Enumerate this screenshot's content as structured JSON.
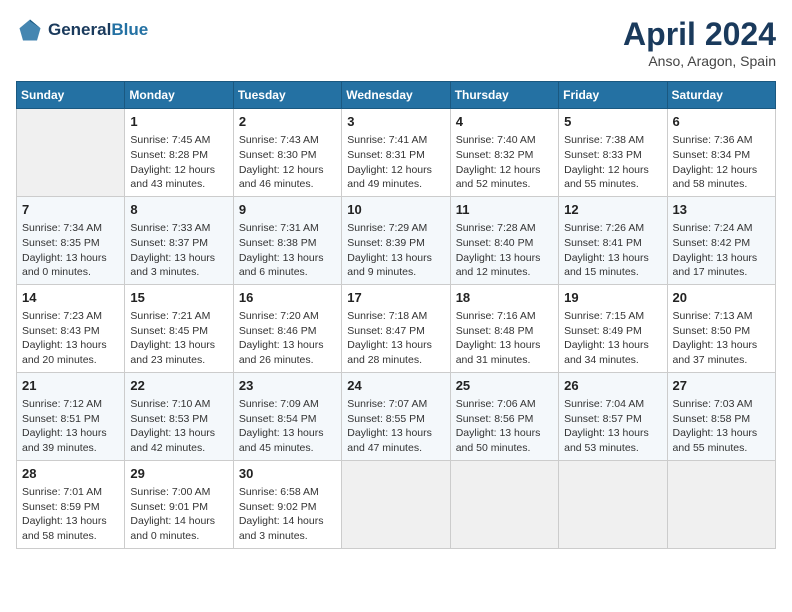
{
  "header": {
    "logo_line1": "General",
    "logo_line2": "Blue",
    "month": "April 2024",
    "location": "Anso, Aragon, Spain"
  },
  "days_of_week": [
    "Sunday",
    "Monday",
    "Tuesday",
    "Wednesday",
    "Thursday",
    "Friday",
    "Saturday"
  ],
  "weeks": [
    [
      {
        "day": "",
        "sunrise": "",
        "sunset": "",
        "daylight": ""
      },
      {
        "day": "1",
        "sunrise": "Sunrise: 7:45 AM",
        "sunset": "Sunset: 8:28 PM",
        "daylight": "Daylight: 12 hours and 43 minutes."
      },
      {
        "day": "2",
        "sunrise": "Sunrise: 7:43 AM",
        "sunset": "Sunset: 8:30 PM",
        "daylight": "Daylight: 12 hours and 46 minutes."
      },
      {
        "day": "3",
        "sunrise": "Sunrise: 7:41 AM",
        "sunset": "Sunset: 8:31 PM",
        "daylight": "Daylight: 12 hours and 49 minutes."
      },
      {
        "day": "4",
        "sunrise": "Sunrise: 7:40 AM",
        "sunset": "Sunset: 8:32 PM",
        "daylight": "Daylight: 12 hours and 52 minutes."
      },
      {
        "day": "5",
        "sunrise": "Sunrise: 7:38 AM",
        "sunset": "Sunset: 8:33 PM",
        "daylight": "Daylight: 12 hours and 55 minutes."
      },
      {
        "day": "6",
        "sunrise": "Sunrise: 7:36 AM",
        "sunset": "Sunset: 8:34 PM",
        "daylight": "Daylight: 12 hours and 58 minutes."
      }
    ],
    [
      {
        "day": "7",
        "sunrise": "Sunrise: 7:34 AM",
        "sunset": "Sunset: 8:35 PM",
        "daylight": "Daylight: 13 hours and 0 minutes."
      },
      {
        "day": "8",
        "sunrise": "Sunrise: 7:33 AM",
        "sunset": "Sunset: 8:37 PM",
        "daylight": "Daylight: 13 hours and 3 minutes."
      },
      {
        "day": "9",
        "sunrise": "Sunrise: 7:31 AM",
        "sunset": "Sunset: 8:38 PM",
        "daylight": "Daylight: 13 hours and 6 minutes."
      },
      {
        "day": "10",
        "sunrise": "Sunrise: 7:29 AM",
        "sunset": "Sunset: 8:39 PM",
        "daylight": "Daylight: 13 hours and 9 minutes."
      },
      {
        "day": "11",
        "sunrise": "Sunrise: 7:28 AM",
        "sunset": "Sunset: 8:40 PM",
        "daylight": "Daylight: 13 hours and 12 minutes."
      },
      {
        "day": "12",
        "sunrise": "Sunrise: 7:26 AM",
        "sunset": "Sunset: 8:41 PM",
        "daylight": "Daylight: 13 hours and 15 minutes."
      },
      {
        "day": "13",
        "sunrise": "Sunrise: 7:24 AM",
        "sunset": "Sunset: 8:42 PM",
        "daylight": "Daylight: 13 hours and 17 minutes."
      }
    ],
    [
      {
        "day": "14",
        "sunrise": "Sunrise: 7:23 AM",
        "sunset": "Sunset: 8:43 PM",
        "daylight": "Daylight: 13 hours and 20 minutes."
      },
      {
        "day": "15",
        "sunrise": "Sunrise: 7:21 AM",
        "sunset": "Sunset: 8:45 PM",
        "daylight": "Daylight: 13 hours and 23 minutes."
      },
      {
        "day": "16",
        "sunrise": "Sunrise: 7:20 AM",
        "sunset": "Sunset: 8:46 PM",
        "daylight": "Daylight: 13 hours and 26 minutes."
      },
      {
        "day": "17",
        "sunrise": "Sunrise: 7:18 AM",
        "sunset": "Sunset: 8:47 PM",
        "daylight": "Daylight: 13 hours and 28 minutes."
      },
      {
        "day": "18",
        "sunrise": "Sunrise: 7:16 AM",
        "sunset": "Sunset: 8:48 PM",
        "daylight": "Daylight: 13 hours and 31 minutes."
      },
      {
        "day": "19",
        "sunrise": "Sunrise: 7:15 AM",
        "sunset": "Sunset: 8:49 PM",
        "daylight": "Daylight: 13 hours and 34 minutes."
      },
      {
        "day": "20",
        "sunrise": "Sunrise: 7:13 AM",
        "sunset": "Sunset: 8:50 PM",
        "daylight": "Daylight: 13 hours and 37 minutes."
      }
    ],
    [
      {
        "day": "21",
        "sunrise": "Sunrise: 7:12 AM",
        "sunset": "Sunset: 8:51 PM",
        "daylight": "Daylight: 13 hours and 39 minutes."
      },
      {
        "day": "22",
        "sunrise": "Sunrise: 7:10 AM",
        "sunset": "Sunset: 8:53 PM",
        "daylight": "Daylight: 13 hours and 42 minutes."
      },
      {
        "day": "23",
        "sunrise": "Sunrise: 7:09 AM",
        "sunset": "Sunset: 8:54 PM",
        "daylight": "Daylight: 13 hours and 45 minutes."
      },
      {
        "day": "24",
        "sunrise": "Sunrise: 7:07 AM",
        "sunset": "Sunset: 8:55 PM",
        "daylight": "Daylight: 13 hours and 47 minutes."
      },
      {
        "day": "25",
        "sunrise": "Sunrise: 7:06 AM",
        "sunset": "Sunset: 8:56 PM",
        "daylight": "Daylight: 13 hours and 50 minutes."
      },
      {
        "day": "26",
        "sunrise": "Sunrise: 7:04 AM",
        "sunset": "Sunset: 8:57 PM",
        "daylight": "Daylight: 13 hours and 53 minutes."
      },
      {
        "day": "27",
        "sunrise": "Sunrise: 7:03 AM",
        "sunset": "Sunset: 8:58 PM",
        "daylight": "Daylight: 13 hours and 55 minutes."
      }
    ],
    [
      {
        "day": "28",
        "sunrise": "Sunrise: 7:01 AM",
        "sunset": "Sunset: 8:59 PM",
        "daylight": "Daylight: 13 hours and 58 minutes."
      },
      {
        "day": "29",
        "sunrise": "Sunrise: 7:00 AM",
        "sunset": "Sunset: 9:01 PM",
        "daylight": "Daylight: 14 hours and 0 minutes."
      },
      {
        "day": "30",
        "sunrise": "Sunrise: 6:58 AM",
        "sunset": "Sunset: 9:02 PM",
        "daylight": "Daylight: 14 hours and 3 minutes."
      },
      {
        "day": "",
        "sunrise": "",
        "sunset": "",
        "daylight": ""
      },
      {
        "day": "",
        "sunrise": "",
        "sunset": "",
        "daylight": ""
      },
      {
        "day": "",
        "sunrise": "",
        "sunset": "",
        "daylight": ""
      },
      {
        "day": "",
        "sunrise": "",
        "sunset": "",
        "daylight": ""
      }
    ]
  ]
}
